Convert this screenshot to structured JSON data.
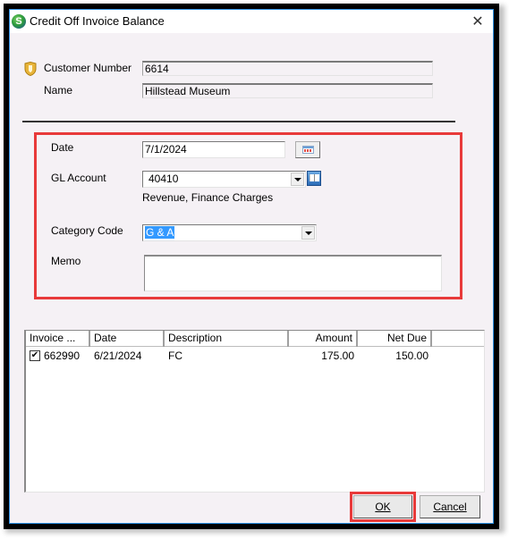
{
  "window": {
    "title": "Credit Off Invoice Balance",
    "app_icon_letter": "S",
    "close_symbol": "✕"
  },
  "customer": {
    "number_label": "Customer Number",
    "number_value": "6614",
    "name_label": "Name",
    "name_value": "Hillstead Museum"
  },
  "form": {
    "date_label": "Date",
    "date_value": "7/1/2024",
    "gl_account_label": "GL Account",
    "gl_account_value": "40410",
    "gl_account_description": "Revenue, Finance Charges",
    "category_code_label": "Category Code",
    "category_code_value": "G & A",
    "memo_label": "Memo",
    "memo_value": ""
  },
  "grid": {
    "columns": [
      "Invoice ...",
      "Date",
      "Description",
      "Amount",
      "Net Due"
    ],
    "rows": [
      {
        "checked": true,
        "invoice": "662990",
        "date": "6/21/2024",
        "description": "FC",
        "amount": "175.00",
        "net_due": "150.00"
      }
    ]
  },
  "buttons": {
    "ok_label": "OK",
    "cancel_label": "Cancel"
  },
  "colors": {
    "highlight_border": "#e83a3a",
    "selection": "#3399ff",
    "window_border": "#2b8ee0"
  }
}
